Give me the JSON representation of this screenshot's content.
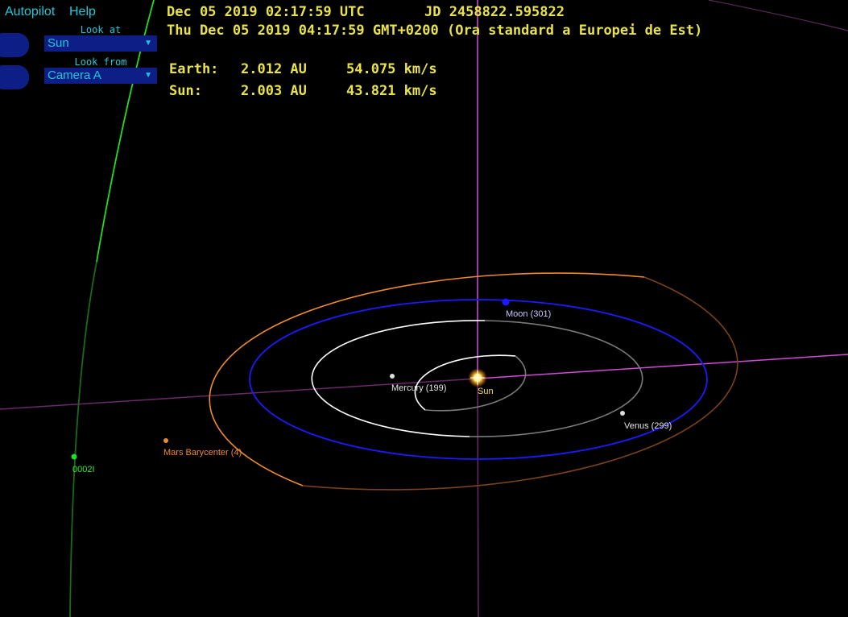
{
  "menu": {
    "autopilot": "Autopilot",
    "help": "Help"
  },
  "controls": {
    "look_at_label": "Look at",
    "look_at_value": "Sun",
    "look_from_label": "Look from",
    "look_from_value": "Camera A"
  },
  "info": {
    "utc": "Dec 05 2019 02:17:59 UTC",
    "jd": "JD 2458822.595822",
    "local": "Thu Dec 05 2019 04:17:59 GMT+0200 (Ora standard a Europei de Est)"
  },
  "stats": {
    "earth": {
      "name": "Earth:",
      "distance": "2.012 AU",
      "speed": "54.075 km/s"
    },
    "sun": {
      "name": "Sun:",
      "distance": "2.003 AU",
      "speed": "43.821 km/s"
    }
  },
  "bodies": {
    "moon": "Moon (301)",
    "mercury": "Mercury (199)",
    "sun": "Sun",
    "venus": "Venus (299)",
    "mars": "Mars Barycenter (4)",
    "comet": "0002I"
  },
  "colors": {
    "text_yellow": "#e8e34a",
    "ui_cyan": "#1ec8d8",
    "ui_blue": "#0d1f86",
    "orbit_mars": "#f08a2a",
    "orbit_moon": "#1a1aff",
    "orbit_comet": "#22dd22",
    "axis_magenta": "#d24ad8"
  }
}
